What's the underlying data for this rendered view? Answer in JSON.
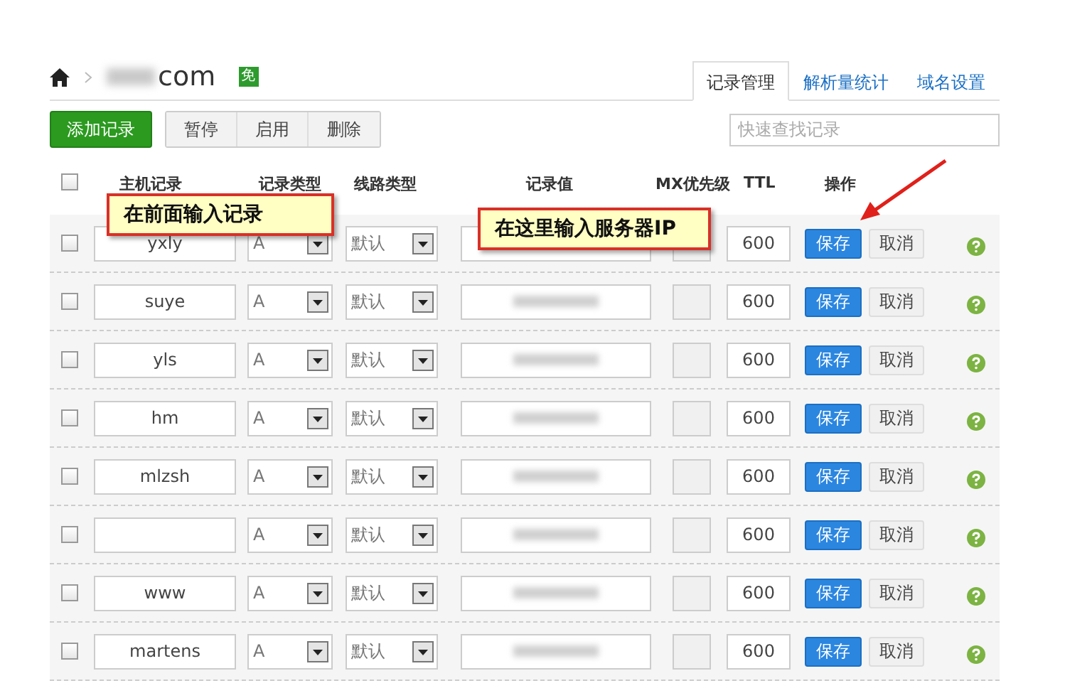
{
  "breadcrumb": {
    "domain_suffix": "com",
    "badge": "免"
  },
  "tabs": [
    {
      "label": "记录管理",
      "selected": true
    },
    {
      "label": "解析量统计",
      "selected": false
    },
    {
      "label": "域名设置",
      "selected": false
    }
  ],
  "toolbar": {
    "add_button": "添加记录",
    "group_buttons": [
      "暂停",
      "启用",
      "删除"
    ]
  },
  "search": {
    "placeholder": "快速查找记录"
  },
  "table": {
    "select_all": {
      "checked": false
    },
    "columns": [
      "主机记录",
      "记录类型",
      "线路类型",
      "记录值",
      "MX优先级",
      "TTL",
      "操作"
    ],
    "rows": [
      {
        "checked": false,
        "host": "yxly",
        "type": "A",
        "line": "默认",
        "ttl": "600",
        "save": "保存",
        "cancel": "取消"
      },
      {
        "checked": false,
        "host": "suye",
        "type": "A",
        "line": "默认",
        "ttl": "600",
        "save": "保存",
        "cancel": "取消"
      },
      {
        "checked": false,
        "host": "yls",
        "type": "A",
        "line": "默认",
        "ttl": "600",
        "save": "保存",
        "cancel": "取消"
      },
      {
        "checked": false,
        "host": "hm",
        "type": "A",
        "line": "默认",
        "ttl": "600",
        "save": "保存",
        "cancel": "取消"
      },
      {
        "checked": false,
        "host": "mlzsh",
        "type": "A",
        "line": "默认",
        "ttl": "600",
        "save": "保存",
        "cancel": "取消"
      },
      {
        "checked": false,
        "host": "",
        "type": "A",
        "line": "默认",
        "ttl": "600",
        "save": "保存",
        "cancel": "取消"
      },
      {
        "checked": false,
        "host": "www",
        "type": "A",
        "line": "默认",
        "ttl": "600",
        "save": "保存",
        "cancel": "取消"
      },
      {
        "checked": false,
        "host": "martens",
        "type": "A",
        "line": "默认",
        "ttl": "600",
        "save": "保存",
        "cancel": "取消"
      }
    ]
  },
  "callouts": [
    "在前面输入记录",
    "在这里输入服务器IP"
  ]
}
